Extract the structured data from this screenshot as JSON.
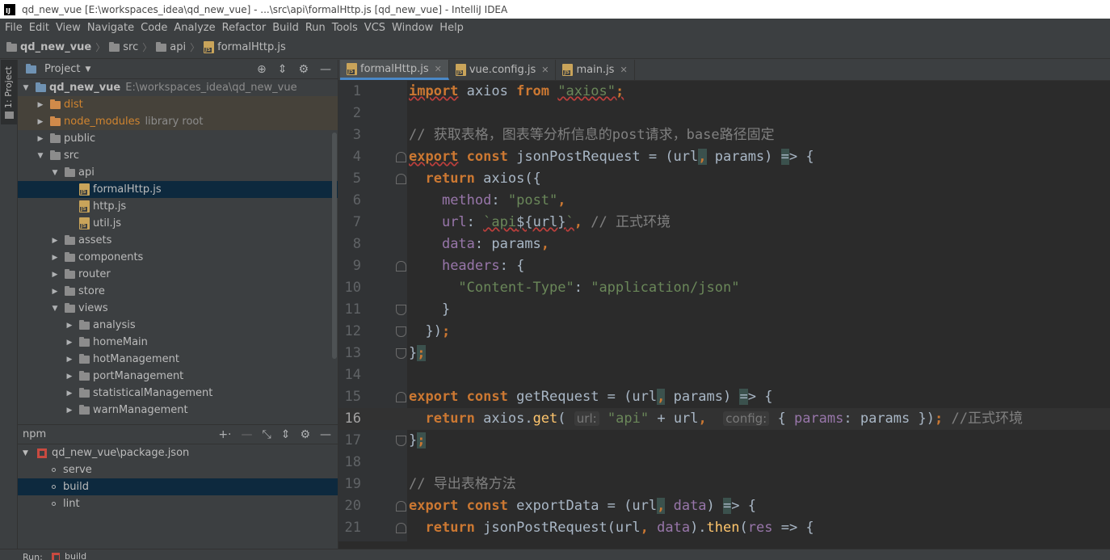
{
  "window": {
    "title": "qd_new_vue [E:\\workspaces_idea\\qd_new_vue] - ...\\src\\api\\formalHttp.js [qd_new_vue] - IntelliJ IDEA",
    "app_icon": "IJ"
  },
  "menu": [
    "File",
    "Edit",
    "View",
    "Navigate",
    "Code",
    "Analyze",
    "Refactor",
    "Build",
    "Run",
    "Tools",
    "VCS",
    "Window",
    "Help"
  ],
  "breadcrumb": [
    "qd_new_vue",
    "src",
    "api",
    "formalHttp.js"
  ],
  "toolstrip": {
    "project_tab": "1: Project"
  },
  "project_panel": {
    "title": "Project",
    "tree": [
      {
        "name": "qd_new_vue",
        "extra": "E:\\workspaces_idea\\qd_new_vue",
        "level": 0,
        "arrow": "down",
        "icon": "module"
      },
      {
        "name": "dist",
        "extra": "",
        "level": 1,
        "arrow": "right",
        "icon": "folder-orange"
      },
      {
        "name": "node_modules",
        "extra": "library root",
        "level": 1,
        "arrow": "right",
        "icon": "folder-orange"
      },
      {
        "name": "public",
        "extra": "",
        "level": 1,
        "arrow": "right",
        "icon": "folder"
      },
      {
        "name": "src",
        "extra": "",
        "level": 1,
        "arrow": "down",
        "icon": "folder"
      },
      {
        "name": "api",
        "extra": "",
        "level": 2,
        "arrow": "down",
        "icon": "folder"
      },
      {
        "name": "formalHttp.js",
        "extra": "",
        "level": 3,
        "arrow": "",
        "icon": "js"
      },
      {
        "name": "http.js",
        "extra": "",
        "level": 3,
        "arrow": "",
        "icon": "js"
      },
      {
        "name": "util.js",
        "extra": "",
        "level": 3,
        "arrow": "",
        "icon": "js"
      },
      {
        "name": "assets",
        "extra": "",
        "level": 2,
        "arrow": "right",
        "icon": "folder"
      },
      {
        "name": "components",
        "extra": "",
        "level": 2,
        "arrow": "right",
        "icon": "folder"
      },
      {
        "name": "router",
        "extra": "",
        "level": 2,
        "arrow": "right",
        "icon": "folder"
      },
      {
        "name": "store",
        "extra": "",
        "level": 2,
        "arrow": "right",
        "icon": "folder"
      },
      {
        "name": "views",
        "extra": "",
        "level": 2,
        "arrow": "down",
        "icon": "folder"
      },
      {
        "name": "analysis",
        "extra": "",
        "level": 3,
        "arrow": "right",
        "icon": "folder"
      },
      {
        "name": "homeMain",
        "extra": "",
        "level": 3,
        "arrow": "right",
        "icon": "folder"
      },
      {
        "name": "hotManagement",
        "extra": "",
        "level": 3,
        "arrow": "right",
        "icon": "folder"
      },
      {
        "name": "portManagement",
        "extra": "",
        "level": 3,
        "arrow": "right",
        "icon": "folder"
      },
      {
        "name": "statisticalManagement",
        "extra": "",
        "level": 3,
        "arrow": "right",
        "icon": "folder"
      },
      {
        "name": "warnManagement",
        "extra": "",
        "level": 3,
        "arrow": "right",
        "icon": "folder"
      }
    ]
  },
  "npm_panel": {
    "title": "npm",
    "package": "qd_new_vue\\package.json",
    "scripts": [
      "serve",
      "build",
      "lint"
    ],
    "selected_script": "build"
  },
  "editor": {
    "tabs": [
      {
        "label": "formalHttp.js",
        "active": true
      },
      {
        "label": "vue.config.js",
        "active": false
      },
      {
        "label": "main.js",
        "active": false
      }
    ]
  },
  "bottom": {
    "run_label": "Run:",
    "run_config": "build"
  }
}
